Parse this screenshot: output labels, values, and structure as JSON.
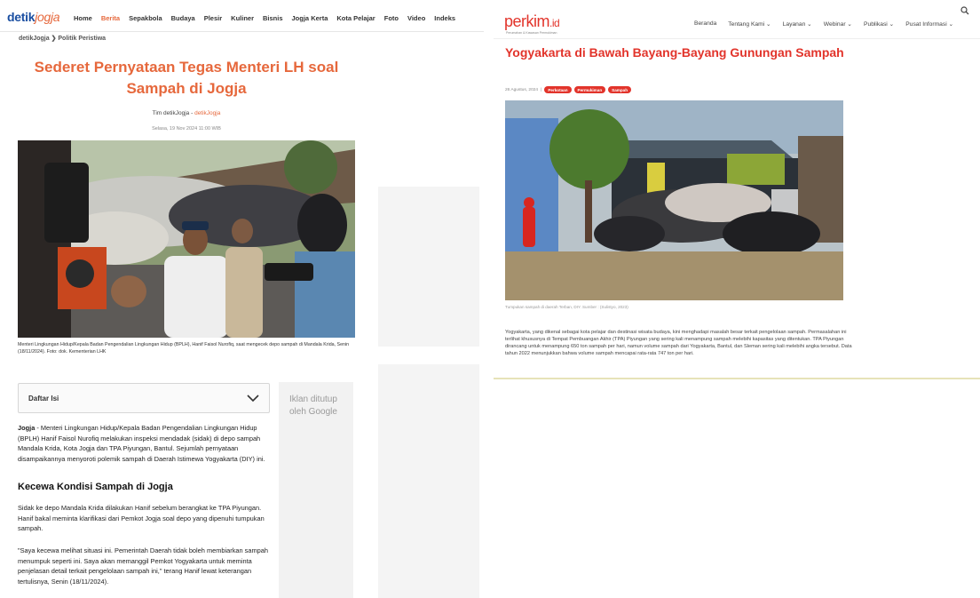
{
  "detik": {
    "logo_part1": "detik",
    "logo_part2": "jogja",
    "nav": [
      "Home",
      "Berita",
      "Sepakbola",
      "Budaya",
      "Plesir",
      "Kuliner",
      "Bisnis",
      "Jogja Kerta",
      "Kota Pelajar",
      "Foto",
      "Video",
      "Indeks"
    ],
    "active_nav": "Berita",
    "breadcrumb": "detikJogja  ❯  Politik Peristiwa",
    "title": "Sederet Pernyataan Tegas Menteri LH soal Sampah di Jogja",
    "author": "Tim detikJogja",
    "author_sep": " - ",
    "author_source": "detikJogja",
    "date": "Selasa, 19 Nov 2024 11:00 WIB",
    "caption": "Menteri Lingkungan Hidup/Kepala Badan Pengendalian Lingkungan Hidup (BPLH), Hanif Faisol Nurofiq, saat mengecek depo sampah di Mandala Krida, Senin (18/11/2024). Foto: dok. Kementerian LHK",
    "toc_label": "Daftar Isi",
    "ad_text": "Iklan ditutup oleh Google",
    "p1_lead": "Jogja",
    "p1": " - Menteri Lingkungan Hidup/Kepala Badan Pengendalian Lingkungan Hidup (BPLH) Hanif Faisol Nurofiq melakukan inspeksi mendadak (sidak) di depo sampah Mandala Krida, Kota Jogja dan TPA Piyungan, Bantul. Sejumlah pernyataan disampaikannya menyoroti polemik sampah di Daerah Istimewa Yogyakarta (DIY) ini.",
    "h2": "Kecewa Kondisi Sampah di Jogja",
    "p2": "Sidak ke depo Mandala Krida dilakukan Hanif sebelum berangkat ke TPA Piyungan. Hanif bakal meminta klarifikasi dari Pemkot Jogja soal depo yang dipenuhi tumpukan sampah.",
    "p3": "\"Saya kecewa melihat situasi ini. Pemerintah Daerah tidak boleh membiarkan sampah menumpuk seperti ini. Saya akan memanggil Pemkot Yogyakarta untuk meminta penjelasan detail terkait pengelolaan sampah ini,\" terang Hanif lewat keterangan tertulisnya, Senin (18/11/2024)."
  },
  "perkim": {
    "logo": "perkim",
    "logo_suffix": ".id",
    "tagline": "Perumahan & Kawasan Permukiman",
    "nav": [
      "Beranda",
      "Tentang Kami ⌄",
      "Layanan ⌄",
      "Webinar ⌄",
      "Publikasi ⌄",
      "Pusat Informasi ⌄"
    ],
    "title": "Yogyakarta di Bawah Bayang-Bayang Gunungan Sampah",
    "date": "26 Agustus, 2024",
    "date_sep": "|",
    "tags": [
      "Perkotaan",
      "Permukiman",
      "Sampah"
    ],
    "caption": "Tumpukan sampah di daerah Terban, DIY. Sumber : (Sulistyo, 2023)",
    "body": "Yogyakarta, yang dikenal sebagai kota pelajar dan destinasi wisata budaya, kini menghadapi masalah besar terkait pengelolaan sampah. Permasalahan ini terlihat khususnya di Tempat Pembuangan Akhir (TPA) Piyungan yang sering kali menampung sampah melebihi kapasitas yang ditentukan. TPA Piyungan dirancang untuk menampung 650 ton sampah per hari, namun volume sampah dari Yogyakarta, Bantul, dan Sleman sering kali melebihi angka tersebut. Data tahun 2022 menunjukkan bahwa volume sampah mencapai rata-rata 747 ton per hari."
  },
  "colors": {
    "detik_accent": "#e6683c",
    "detik_blue": "#1a4ea1",
    "perkim_red": "#e2342b"
  }
}
